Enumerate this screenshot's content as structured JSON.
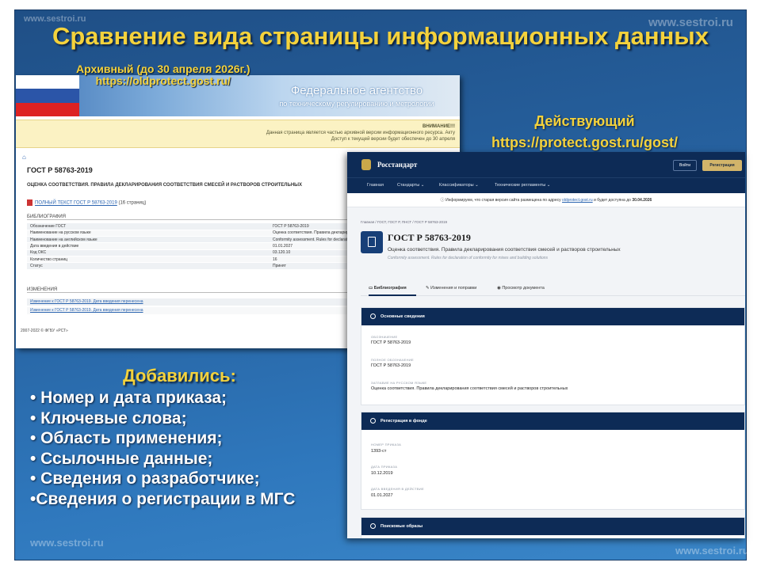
{
  "watermark": "www.sestroi.ru",
  "title": "Сравнение вида страницы информационных данных",
  "archive_label": {
    "line1": "Архивный (до 30 апреля 2026г.)",
    "line2": "https://oldprotect.gost.ru/"
  },
  "current_label": {
    "line1": "Действующий",
    "line2": "https://protect.gost.ru/gost/"
  },
  "old_site": {
    "agency_line1": "Федеральное агентство",
    "agency_line2": "по техническому регулированию и метрологии",
    "warning_title": "ВНИМАНИЕ!!!",
    "warning_line1": "Данная страница является частью архивной версии информационного ресурса. Акту",
    "warning_line2": "Доступ к текущей версии будет обеспечен до 30 апреля",
    "home_icon": "home-icon",
    "doc_title": "ГОСТ Р 58763-2019",
    "doc_subtitle": "ОЦЕНКА СООТВЕТСТВИЯ. ПРАВИЛА ДЕКЛАРИРОВАНИЯ СООТВЕТСТВИЯ СМЕСЕЙ И РАСТВОРОВ СТРОИТЕЛЬНЫХ",
    "full_text_link": "ПОЛНЫЙ ТЕКСТ ГОСТ Р 58763-2019",
    "full_text_pages": "(16 страниц)",
    "biblio_header": "БИБЛИОГРАФИЯ",
    "biblio": [
      {
        "k": "Обозначение ГОСТ",
        "v": "ГОСТ Р 58763-2019"
      },
      {
        "k": "Наименование на русском языке",
        "v": "Оценка соответствия. Правила декларирован"
      },
      {
        "k": "Наименование на английском языке",
        "v": "Conformity assessment. Rules for declaration o"
      },
      {
        "k": "Дата введения в действие",
        "v": "01.01.2027"
      },
      {
        "k": "Код ОКС",
        "v": "03.120.10"
      },
      {
        "k": "Количество страниц",
        "v": "16"
      },
      {
        "k": "Статус",
        "v": "Принят"
      }
    ],
    "changes_header": "ИЗМЕНЕНИЯ",
    "changes": [
      "Изменение к ГОСТ Р 58763-2019. Дата введения перенесена",
      "Изменение к ГОСТ Р 58763-2019. Дата введения перенесена"
    ],
    "footer": "2007-2022 © ФГБУ «РСТ»"
  },
  "new_site": {
    "brand": "Росстандарт",
    "login": "Войти",
    "register": "Регистрация",
    "nav": [
      "Главная",
      "Стандарты",
      "Классификаторы",
      "Технические регламенты"
    ],
    "info_pre": "Информируем, что старая версия сайта размещена по адресу",
    "info_link": "oldprotect.gost.ru",
    "info_post": "и будет доступна до",
    "info_date": "30.04.2026",
    "breadcrumb": "Главная / ГОСТ, ГОСТ Р, ПНСТ / ГОСТ Р 58763-2019",
    "doc_title": "ГОСТ Р 58763-2019",
    "doc_subtitle": "Оценка соответствия. Правила декларирования соответствия смесей и растворов строительных",
    "doc_subtitle_en": "Conformity assessment. Rules for declaration of conformity for mixes and building solutions",
    "tabs": [
      "Библиография",
      "Изменения и поправки",
      "Просмотр документа"
    ],
    "card1": {
      "title": "Основные сведения",
      "fields": [
        {
          "label": "ОБОЗНАЧЕНИЕ",
          "value": "ГОСТ Р 58763-2019"
        },
        {
          "label": "ПОЛНОЕ ОБОЗНАЧЕНИЕ",
          "value": "ГОСТ Р 58763-2019"
        },
        {
          "label": "ЗАГЛАВИЕ НА РУССКОМ ЯЗЫКЕ",
          "value": "Оценка соответствия. Правила декларирования соответствия смесей и растворов строительных"
        }
      ]
    },
    "card2": {
      "title": "Регистрация в фонде",
      "fields": [
        {
          "label": "НОМЕР ПРИКАЗА",
          "value": "1393-ст"
        },
        {
          "label": "ДАТА ПРИКАЗА",
          "value": "10.12.2019"
        },
        {
          "label": "ДАТА ВВЕДЕНИЯ В ДЕЙСТВИЕ",
          "value": "01.01.2027"
        }
      ]
    },
    "card3": {
      "title": "Поисковые образы"
    }
  },
  "added_title": "Добавились:",
  "added_items": [
    "• Номер и дата приказа;",
    "• Ключевые слова;",
    "• Область применения;",
    "• Ссылочные данные;",
    "• Сведения о разработчике;",
    "•Сведения о регистрации в МГС"
  ]
}
